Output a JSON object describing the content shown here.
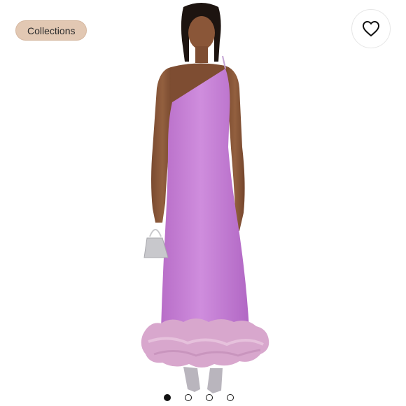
{
  "header": {
    "collections_label": "Collections"
  },
  "actions": {
    "like_icon": "heart-icon"
  },
  "gallery": {
    "dots": [
      {
        "active": true
      },
      {
        "active": false
      },
      {
        "active": false
      },
      {
        "active": false
      }
    ]
  },
  "colors": {
    "chip_background": "#e2c8b3",
    "dress": "#c77ed6",
    "feather_trim": "#d9a9cf"
  }
}
